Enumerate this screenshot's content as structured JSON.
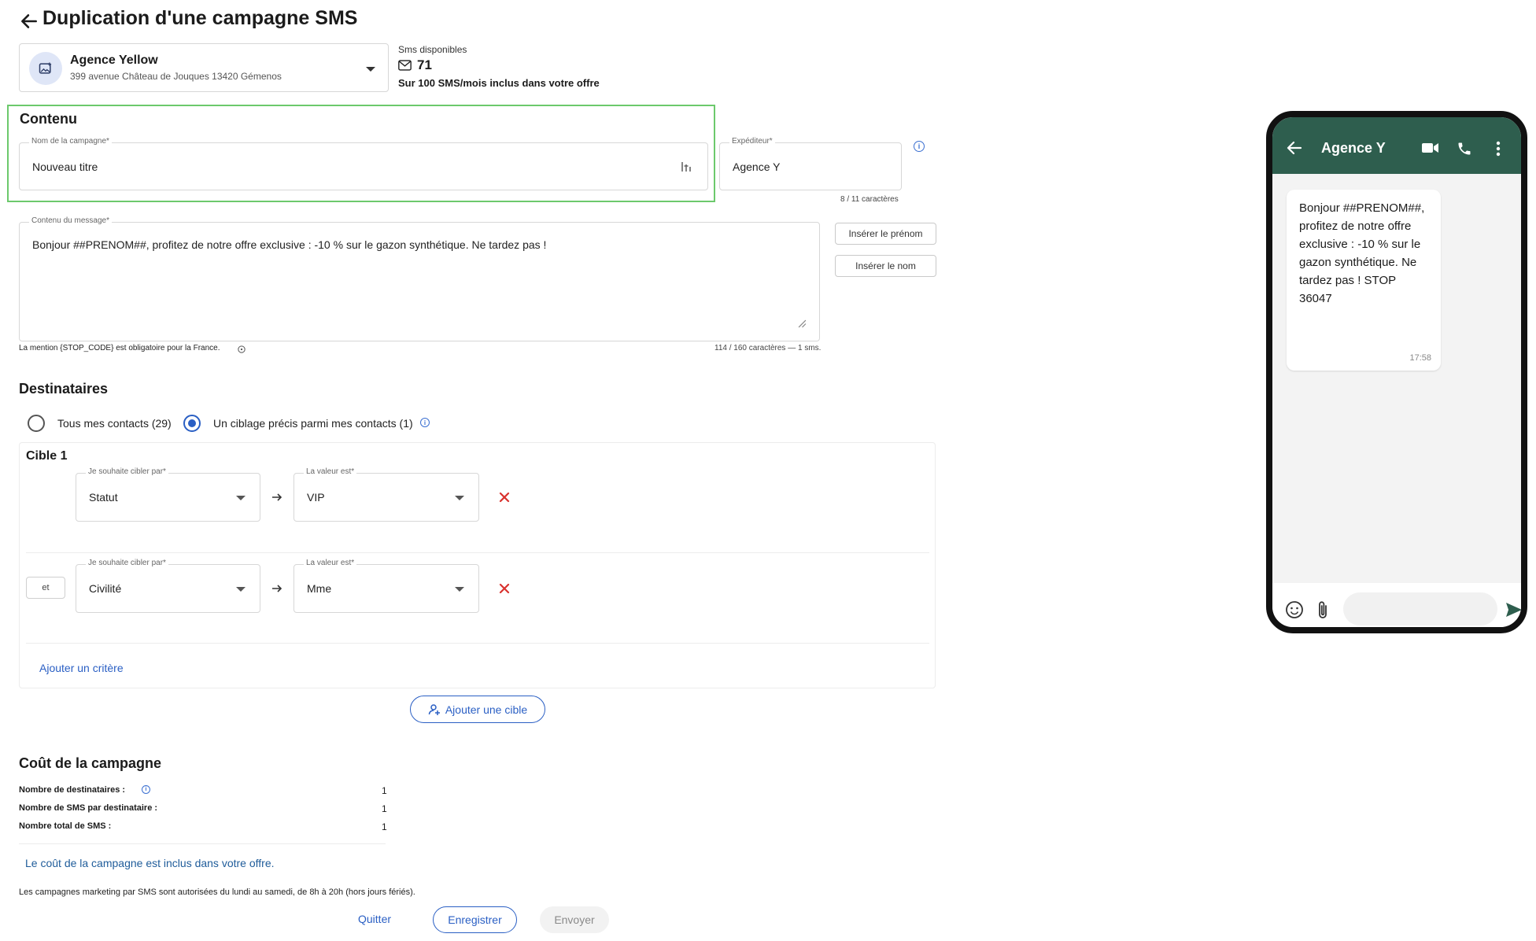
{
  "header": {
    "title": "Duplication d'une campagne SMS"
  },
  "agency": {
    "name": "Agence Yellow",
    "address": "399 avenue Château de Jouques 13420 Gémenos"
  },
  "sms": {
    "label": "Sms disponibles",
    "count": "71",
    "offer": "Sur 100 SMS/mois inclus dans votre offre"
  },
  "contenu": {
    "title": "Contenu",
    "campaign_name_label": "Nom de la campagne*",
    "campaign_name_value": "Nouveau titre",
    "sender_label": "Expéditeur*",
    "sender_value": "Agence Y",
    "sender_counter": "8 / 11 caractères",
    "message_label": "Contenu du message*",
    "message_value": "Bonjour ##PRENOM##, profitez de notre offre exclusive : -10 % sur le gazon synthétique. Ne tardez pas !",
    "insert_firstname": "Insérer le prénom",
    "insert_lastname": "Insérer le nom",
    "stop_note": "La mention {STOP_CODE} est obligatoire pour la France.",
    "message_counter": "114 / 160 caractères — 1 sms."
  },
  "destinataires": {
    "title": "Destinataires",
    "option_all": "Tous mes contacts (29)",
    "option_targeted": "Un ciblage précis parmi mes contacts (1)",
    "selected": "targeted"
  },
  "target": {
    "title": "Cible 1",
    "criteria": [
      {
        "field_label": "Je souhaite cibler par*",
        "field_value": "Statut",
        "value_label": "La valeur est*",
        "value": "VIP"
      },
      {
        "connector": "et",
        "field_label": "Je souhaite cibler par*",
        "field_value": "Civilité",
        "value_label": "La valeur est*",
        "value": "Mme"
      }
    ],
    "add_criterion": "Ajouter un critère",
    "add_target": "Ajouter une cible"
  },
  "cost": {
    "title": "Coût de la campagne",
    "rows": [
      {
        "label": "Nombre de destinataires :",
        "value": "1"
      },
      {
        "label": "Nombre de SMS par destinataire :",
        "value": "1"
      },
      {
        "label": "Nombre total de SMS :",
        "value": "1"
      }
    ],
    "included": "Le coût de la campagne est inclus dans votre offre.",
    "notice": "Les campagnes marketing par SMS sont autorisées du lundi au samedi, de 8h à 20h (hors jours fériés)."
  },
  "actions": {
    "quit": "Quitter",
    "save": "Enregistrer",
    "send": "Envoyer"
  },
  "phone": {
    "contact": "Agence Y",
    "message": "Bonjour ##PRENOM##, profitez de notre offre exclusive : -10 % sur le gazon synthétique. Ne tardez pas ! STOP 36047",
    "time": "17:58"
  },
  "colors": {
    "accent": "#2a5fc4",
    "phone_header": "#2e5e4e",
    "highlight": "#6cc96c",
    "danger": "#d9322e"
  }
}
